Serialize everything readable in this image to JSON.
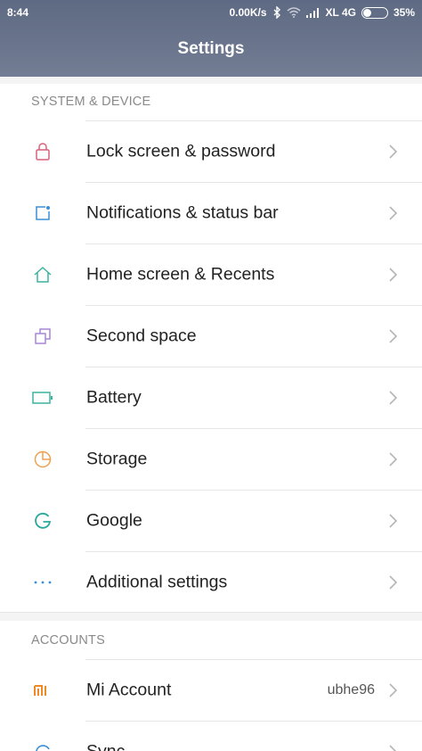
{
  "status_bar": {
    "time": "8:44",
    "speed": "0.00K/s",
    "carrier": "XL 4G",
    "battery_level": "35%",
    "battery_fraction": 0.35
  },
  "header": {
    "title": "Settings"
  },
  "sections": {
    "system": {
      "title": "SYSTEM & DEVICE",
      "items": [
        {
          "label": "Lock screen & password",
          "icon": "lock-icon",
          "color": "#d9607a"
        },
        {
          "label": "Notifications & status bar",
          "icon": "notification-icon",
          "color": "#3a8fd8"
        },
        {
          "label": "Home screen & Recents",
          "icon": "home-icon",
          "color": "#3bb3a0"
        },
        {
          "label": "Second space",
          "icon": "second-space-icon",
          "color": "#a786d6"
        },
        {
          "label": "Battery",
          "icon": "battery-icon",
          "color": "#3bb3a0"
        },
        {
          "label": "Storage",
          "icon": "storage-icon",
          "color": "#f0a050"
        },
        {
          "label": "Google",
          "icon": "google-icon",
          "color": "#2aa79b"
        },
        {
          "label": "Additional settings",
          "icon": "more-icon",
          "color": "#3a8fd8"
        }
      ]
    },
    "accounts": {
      "title": "ACCOUNTS",
      "items": [
        {
          "label": "Mi Account",
          "value": "ubhe96",
          "icon": "mi-icon",
          "color": "#f08a24"
        },
        {
          "label": "Sync",
          "icon": "sync-icon",
          "color": "#3a8fd8"
        }
      ]
    }
  }
}
